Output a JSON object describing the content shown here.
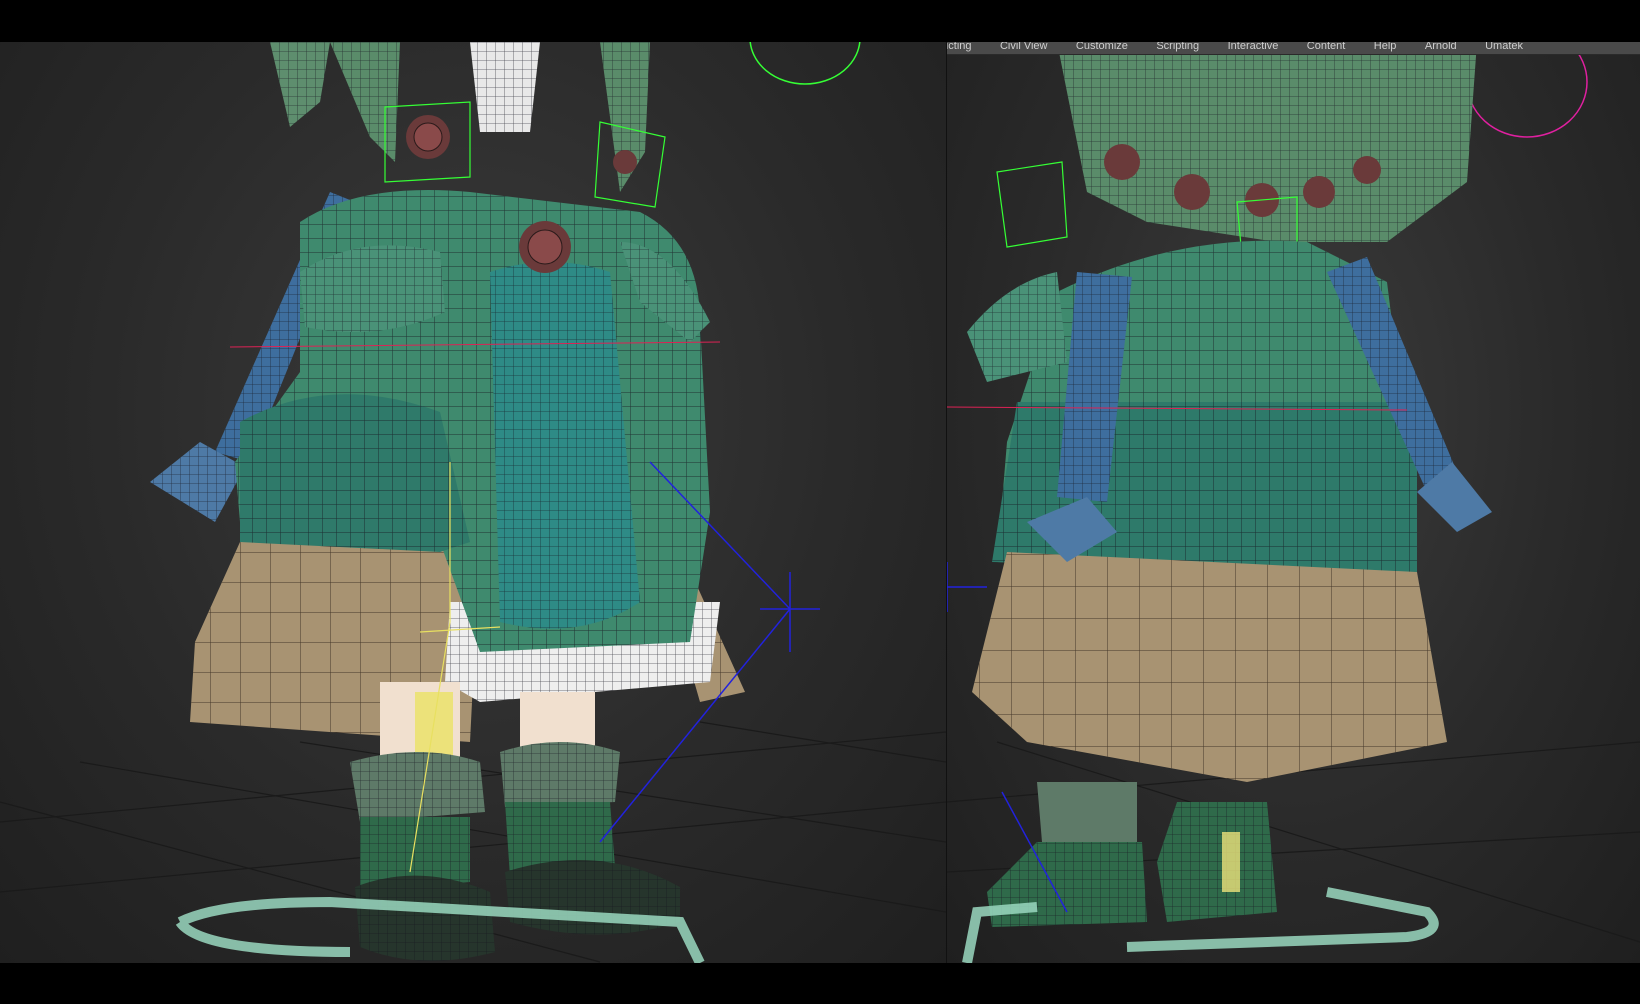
{
  "right_viewport": {
    "menu_items": [
      {
        "label": "...ucting"
      },
      {
        "label": "Civil View"
      },
      {
        "label": "Customize"
      },
      {
        "label": "Scripting"
      },
      {
        "label": "Interactive"
      },
      {
        "label": "Content"
      },
      {
        "label": "Help"
      },
      {
        "label": "Arnold"
      },
      {
        "label": "Umatek"
      }
    ]
  },
  "colors": {
    "viewport_bg": "#2e2e2e",
    "coat_green": "#3f8a6e",
    "apron_teal": "#2e8b86",
    "skirt_tan": "#a89372",
    "sleeve_blue": "#3e6e9e",
    "boot_green": "#2f6a4a",
    "wire": "#1a1a2a",
    "selection_green": "#35ff35",
    "gizmo_blue": "#2222dd",
    "ground_arrow": "#9ad8c0"
  },
  "icons": [
    "move-gizmo-icon",
    "ground-arrow-icon",
    "selection-bracket-icon"
  ]
}
